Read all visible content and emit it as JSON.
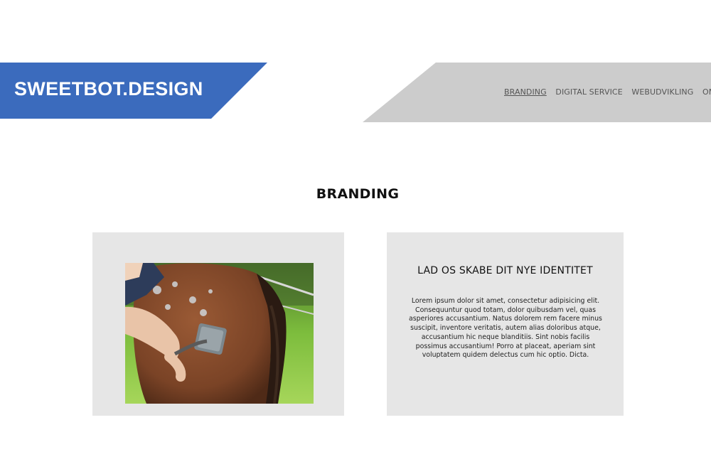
{
  "header": {
    "logo_text": "SWEETBOT.DESIGN",
    "colors": {
      "logo_band": "#3b6bbd",
      "nav_band": "#cccccc"
    }
  },
  "nav": {
    "items": [
      {
        "label": "BRANDING",
        "active": true
      },
      {
        "label": "DIGITAL SERVICE",
        "active": false
      },
      {
        "label": "WEBUDVIKLING",
        "active": false
      },
      {
        "label": "OM OS",
        "active": false
      }
    ]
  },
  "main": {
    "section_title": "BRANDING",
    "card_image": {
      "description_icon": "horse-grooming-photo"
    },
    "card_text": {
      "heading": "LAD OS SKABE DIT NYE IDENTITET",
      "body": "Lorem ipsum dolor sit amet, consectetur adipisicing elit. Consequuntur quod totam, dolor quibusdam vel, quas asperiores accusantium. Natus dolorem rem facere minus suscipit, inventore veritatis, autem alias doloribus atque, accusantium hic neque blanditiis. Sint nobis facilis possimus accusantium! Porro at placeat, aperiam sint voluptatem quidem delectus cum hic optio. Dicta."
    }
  }
}
